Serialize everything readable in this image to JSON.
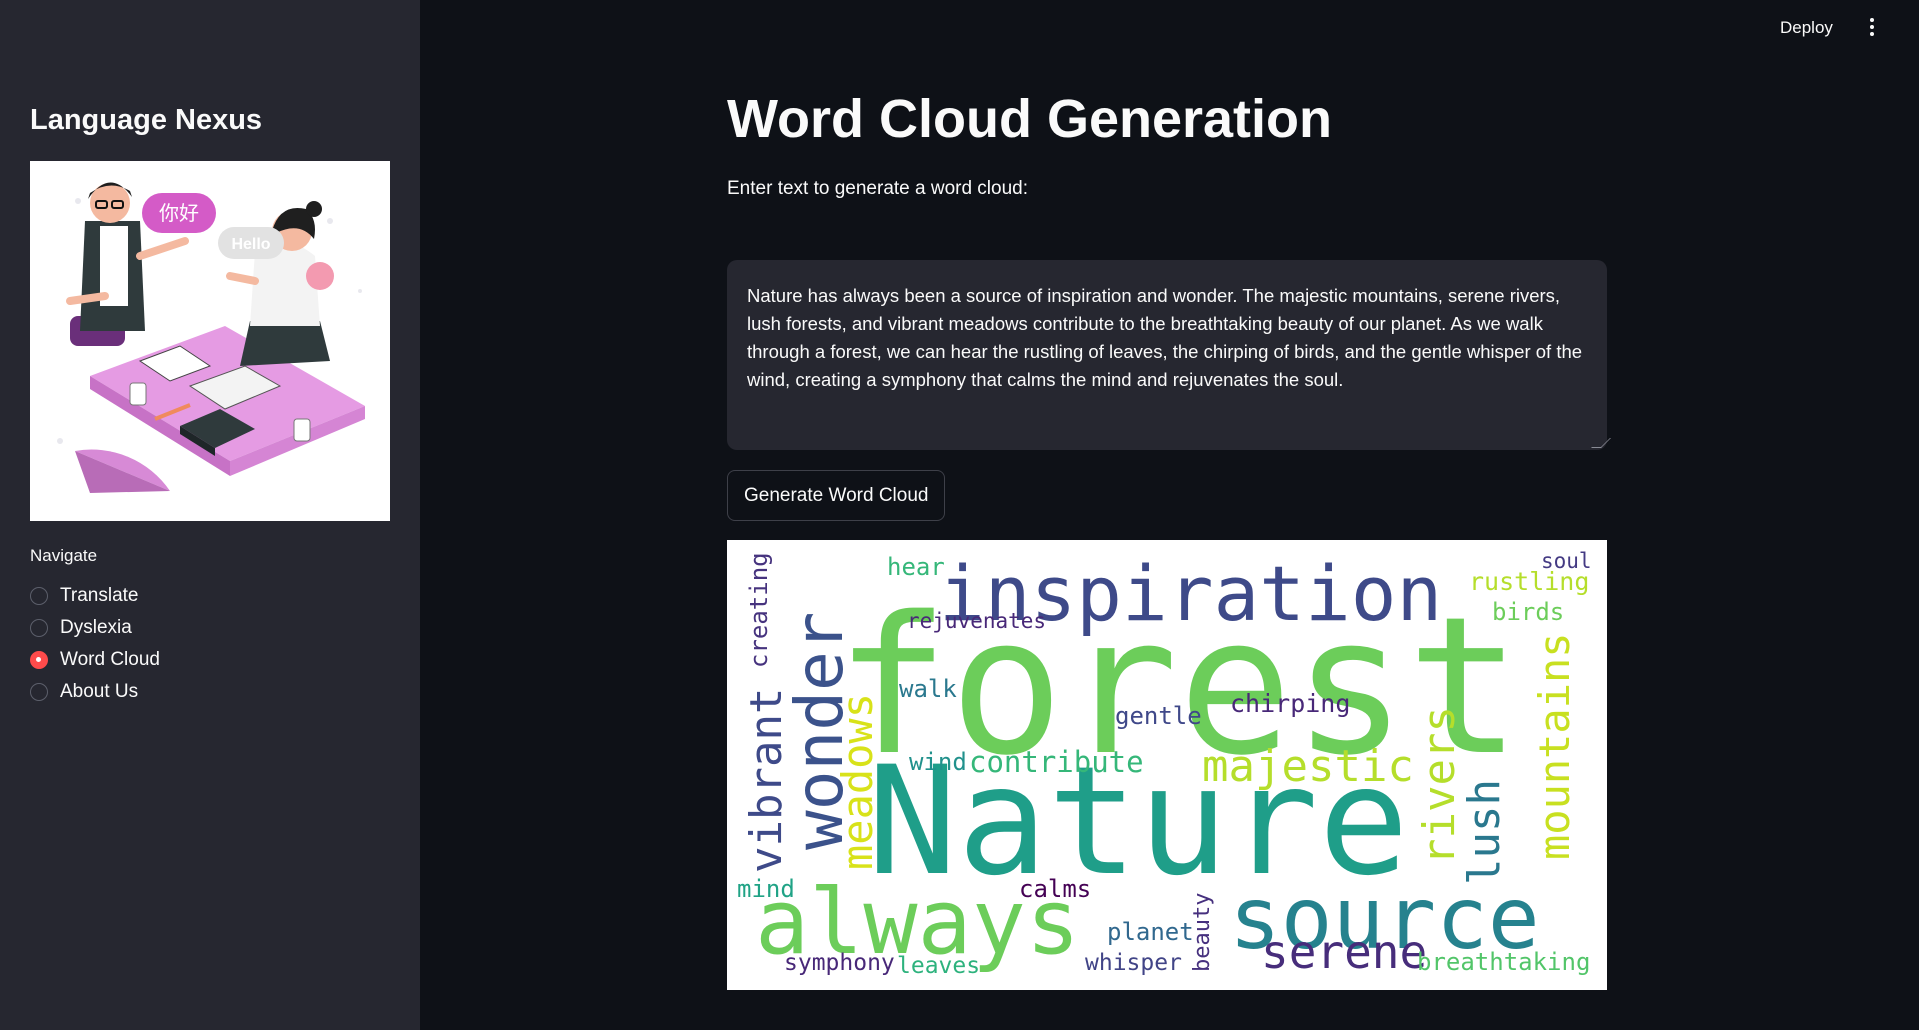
{
  "topbar": {
    "deploy_label": "Deploy"
  },
  "sidebar": {
    "title": "Language Nexus",
    "illustration": {
      "bubble_chinese": "你好",
      "bubble_english": "Hello"
    },
    "nav_label": "Navigate",
    "nav_items": [
      {
        "label": "Translate",
        "selected": false
      },
      {
        "label": "Dyslexia",
        "selected": false
      },
      {
        "label": "Word Cloud",
        "selected": true
      },
      {
        "label": "About Us",
        "selected": false
      }
    ]
  },
  "main": {
    "title": "Word Cloud Generation",
    "input_label": "Enter text to generate a word cloud:",
    "input_value": "Nature has always been a source of inspiration and wonder. The majestic mountains, serene rivers, lush forests, and vibrant meadows contribute to the breathtaking beauty of our planet. As we walk through a forest, we can hear the rustling of leaves, the chirping of birds, and the gentle whisper of the wind, creating a symphony that calms the mind and rejuvenates the soul.",
    "button_label": "Generate Word Cloud"
  },
  "wordcloud": {
    "words": [
      {
        "text": "forest",
        "color": "#6ccd5a"
      },
      {
        "text": "Nature",
        "color": "#1f9e89"
      },
      {
        "text": "inspiration",
        "color": "#3e4a89"
      },
      {
        "text": "always",
        "color": "#6ccd5a"
      },
      {
        "text": "source",
        "color": "#26828e"
      },
      {
        "text": "wonder",
        "color": "#3b528b"
      },
      {
        "text": "vibrant",
        "color": "#3e4a89"
      },
      {
        "text": "meadows",
        "color": "#d8e219"
      },
      {
        "text": "majestic",
        "color": "#b5de2b"
      },
      {
        "text": "serene",
        "color": "#472d7b"
      },
      {
        "text": "rivers",
        "color": "#b5de2b"
      },
      {
        "text": "lush",
        "color": "#2a788e"
      },
      {
        "text": "mountains",
        "color": "#c8e020"
      },
      {
        "text": "creating",
        "color": "#46337e"
      },
      {
        "text": "hear",
        "color": "#35b779"
      },
      {
        "text": "rejuvenates",
        "color": "#482878"
      },
      {
        "text": "walk",
        "color": "#2a788e"
      },
      {
        "text": "gentle",
        "color": "#3f4889"
      },
      {
        "text": "chirping",
        "color": "#482878"
      },
      {
        "text": "wind",
        "color": "#21918c"
      },
      {
        "text": "contribute",
        "color": "#35b779"
      },
      {
        "text": "soul",
        "color": "#443a83"
      },
      {
        "text": "rustling",
        "color": "#b5de2b"
      },
      {
        "text": "birds",
        "color": "#6ccd5a"
      },
      {
        "text": "mind",
        "color": "#20a386"
      },
      {
        "text": "calms",
        "color": "#440154"
      },
      {
        "text": "planet",
        "color": "#31688e"
      },
      {
        "text": "beauty",
        "color": "#46307e"
      },
      {
        "text": "symphony",
        "color": "#482878"
      },
      {
        "text": "leaves",
        "color": "#2db27d"
      },
      {
        "text": "whisper",
        "color": "#414487"
      },
      {
        "text": "breathtaking",
        "color": "#52c569"
      }
    ]
  }
}
